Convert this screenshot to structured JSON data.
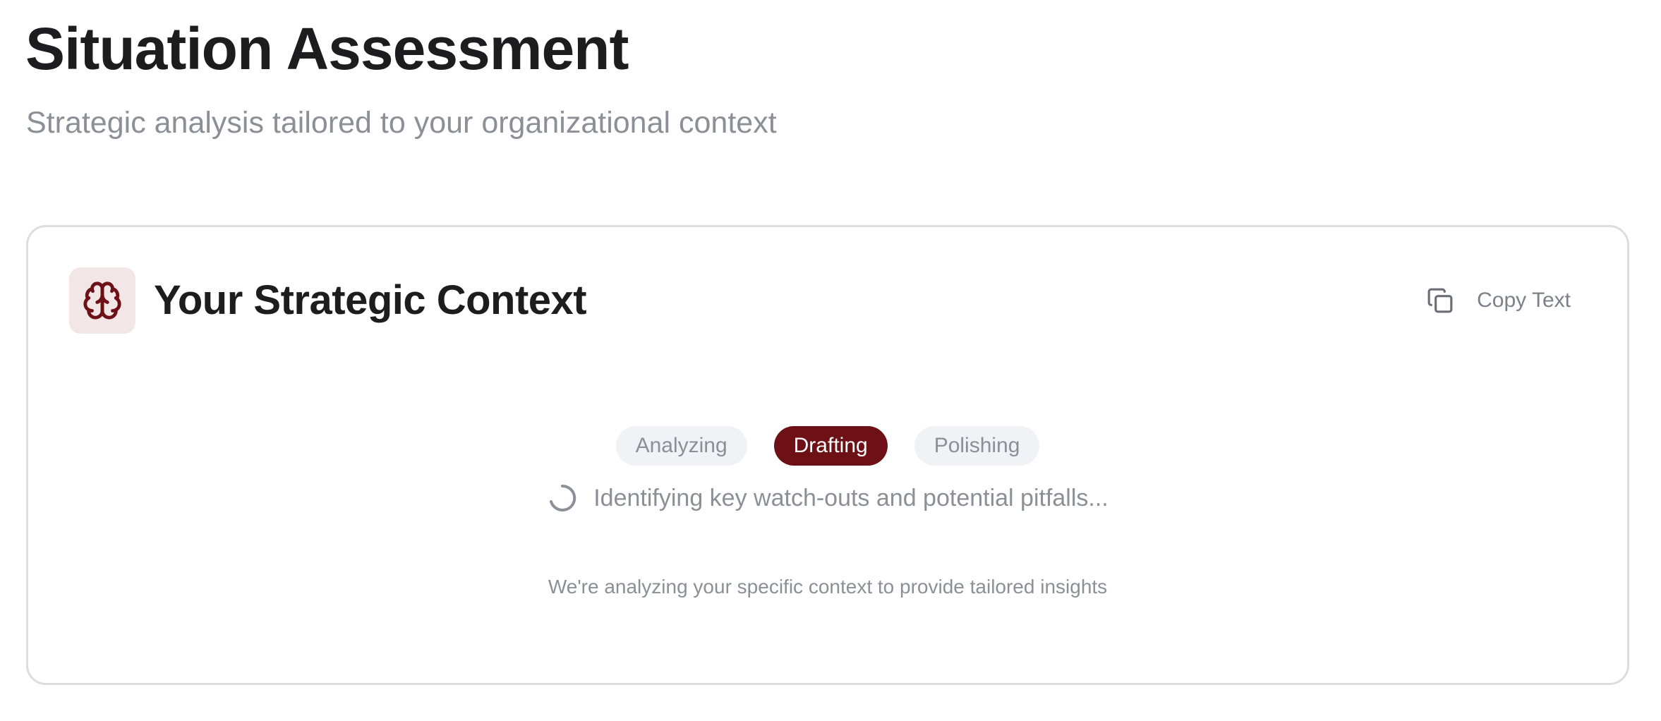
{
  "header": {
    "title": "Situation Assessment",
    "subtitle": "Strategic analysis tailored to your organizational context"
  },
  "card": {
    "icon": "brain-icon",
    "title": "Your Strategic Context",
    "copy_button": {
      "icon": "copy-icon",
      "label": "Copy Text"
    },
    "progress": {
      "steps": [
        {
          "label": "Analyzing",
          "active": false
        },
        {
          "label": "Drafting",
          "active": true
        },
        {
          "label": "Polishing",
          "active": false
        }
      ],
      "status_text": "Identifying key watch-outs and potential pitfalls...",
      "hint": "We're analyzing your specific context to provide tailored insights"
    }
  },
  "colors": {
    "accent": "#6e1117",
    "accent_soft": "#f2e6e6",
    "muted_text": "#8b8f96",
    "border": "#dcdde1"
  }
}
